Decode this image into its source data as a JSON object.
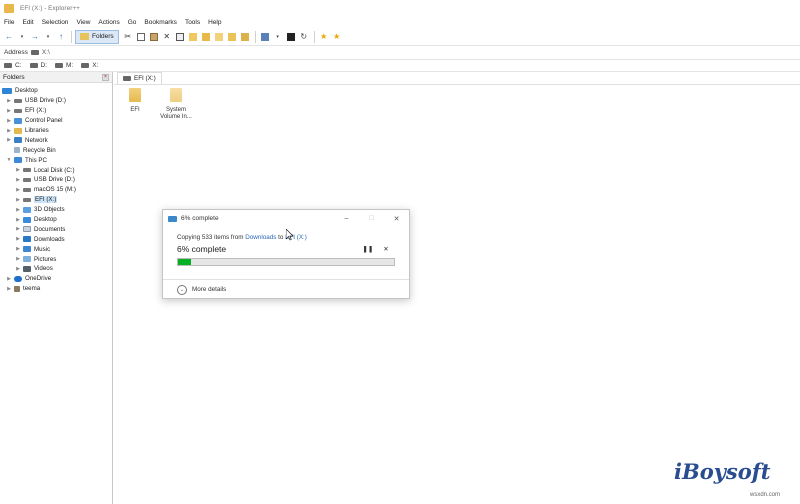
{
  "window": {
    "title": "EFI (X:) - Explorer++"
  },
  "menubar": {
    "items": [
      "File",
      "Edit",
      "Selection",
      "View",
      "Actions",
      "Go",
      "Bookmarks",
      "Tools",
      "Help"
    ]
  },
  "toolbar": {
    "folders_label": "Folders"
  },
  "address": {
    "label": "Address",
    "value": "X:\\"
  },
  "drives": [
    "C:",
    "D:",
    "M:",
    "X:"
  ],
  "folders_panel": {
    "title": "Folders",
    "tree": [
      {
        "label": "Desktop",
        "icon": "desktop-icon"
      },
      {
        "label": "USB Drive (D:)",
        "icon": "drive-icon"
      },
      {
        "label": "EFI (X:)",
        "icon": "drive-icon"
      },
      {
        "label": "Control Panel",
        "icon": "control-panel-icon"
      },
      {
        "label": "Libraries",
        "icon": "libraries-icon"
      },
      {
        "label": "Network",
        "icon": "network-icon"
      },
      {
        "label": "Recycle Bin",
        "icon": "recycle-bin-icon"
      },
      {
        "label": "This PC",
        "icon": "this-pc-icon"
      },
      {
        "label": "Local Disk (C:)",
        "icon": "drive-icon"
      },
      {
        "label": "USB Drive (D:)",
        "icon": "drive-icon"
      },
      {
        "label": "macOS 15 (M:)",
        "icon": "drive-icon"
      },
      {
        "label": "EFI (X:)",
        "icon": "drive-icon"
      },
      {
        "label": "3D Objects",
        "icon": "3d-objects-icon"
      },
      {
        "label": "Desktop",
        "icon": "desktop-icon"
      },
      {
        "label": "Documents",
        "icon": "documents-icon"
      },
      {
        "label": "Downloads",
        "icon": "downloads-icon"
      },
      {
        "label": "Music",
        "icon": "music-icon"
      },
      {
        "label": "Pictures",
        "icon": "pictures-icon"
      },
      {
        "label": "Videos",
        "icon": "videos-icon"
      },
      {
        "label": "OneDrive",
        "icon": "onedrive-icon"
      },
      {
        "label": "teema",
        "icon": "user-icon"
      }
    ]
  },
  "content": {
    "tab_label": "EFI (X:)",
    "files": [
      {
        "name": "EFI",
        "icon": "folder-icon"
      },
      {
        "name": "System Volume In...",
        "icon": "folder-icon"
      }
    ]
  },
  "dialog": {
    "title": "6% complete",
    "copy_prefix": "Copying 533 items from ",
    "copy_source": "Downloads",
    "copy_middle": " to ",
    "copy_dest": "EFI (X:)",
    "status": "6% complete",
    "progress_fraction": 0.06,
    "more_details": "More details",
    "progress_color": "#06b025"
  },
  "watermark": {
    "brand": "iBoysoft",
    "site": "wsxdn.com"
  }
}
